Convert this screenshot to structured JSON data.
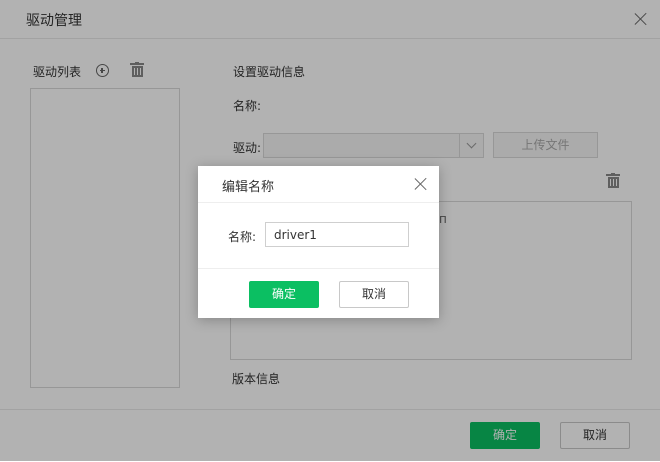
{
  "main_dialog": {
    "title": "驱动管理",
    "list_title": "驱动列表",
    "info_title": "设置驱动信息",
    "name_label": "名称:",
    "driver_label": "驱动:",
    "upload_label": "上传文件",
    "partial_text": "п",
    "version_label": "版本信息",
    "confirm_label": "确定",
    "cancel_label": "取消"
  },
  "edit_dialog": {
    "title": "编辑名称",
    "name_label": "名称:",
    "name_value": "driver1",
    "confirm_label": "确定",
    "cancel_label": "取消"
  },
  "colors": {
    "primary": "#0bbf62",
    "overlay": "#000000"
  },
  "icons": [
    "close-icon",
    "add-circle-icon",
    "trash-icon",
    "chevron-down-icon"
  ]
}
